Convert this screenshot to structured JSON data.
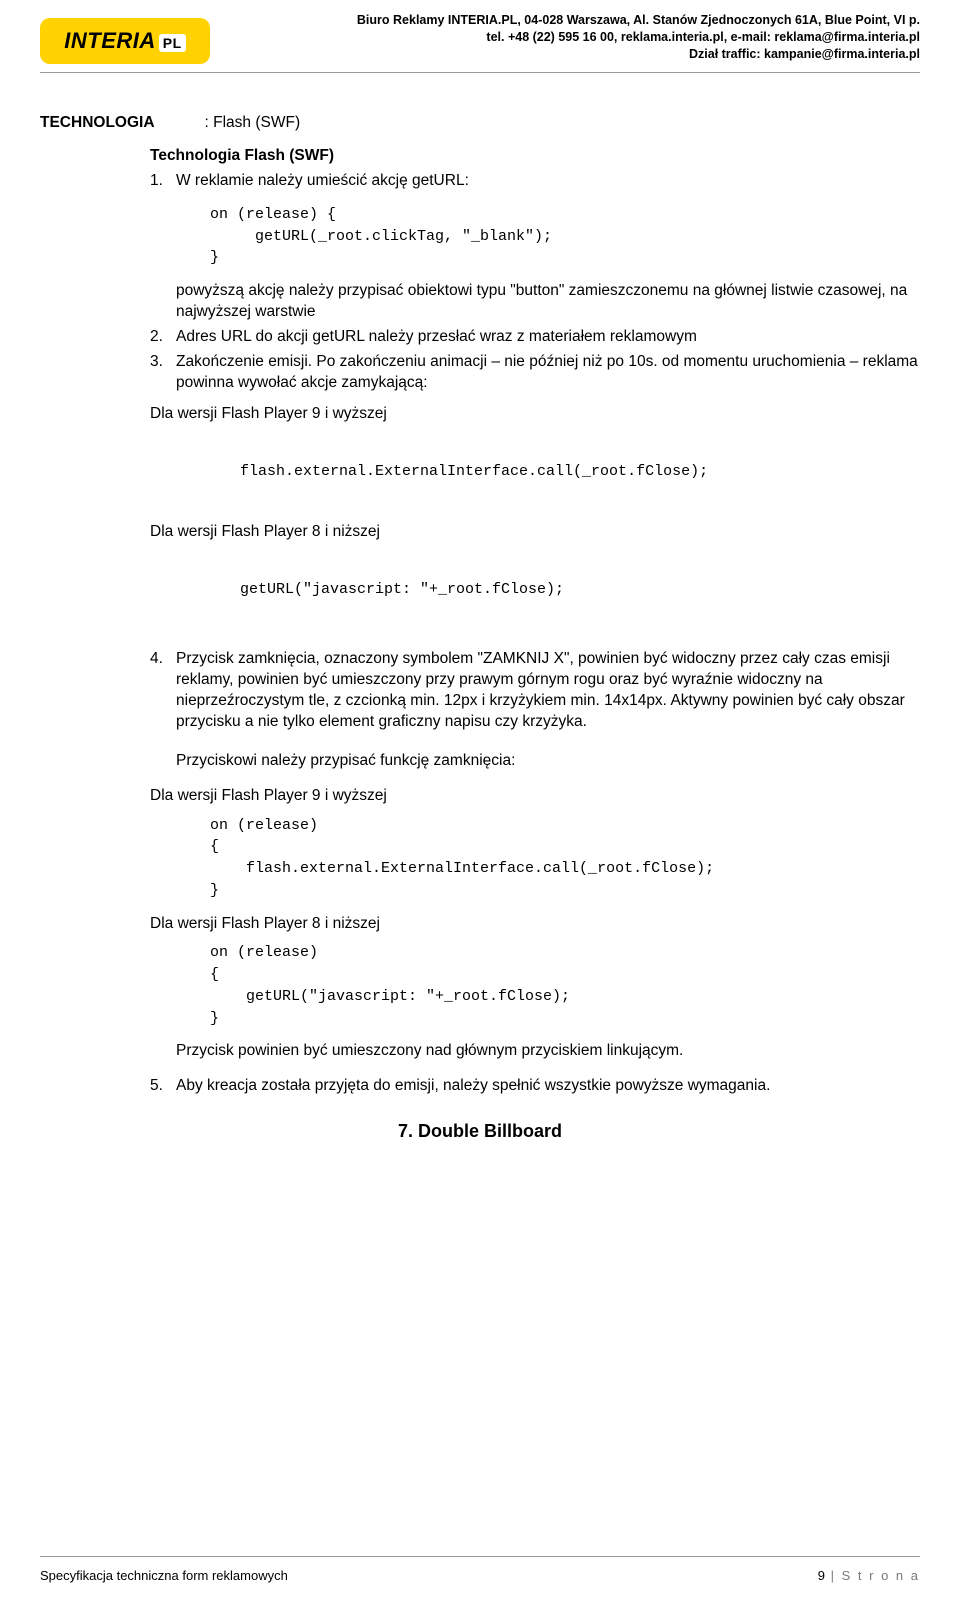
{
  "header": {
    "logo_main": "INTERIA",
    "logo_suffix": "PL",
    "line1": "Biuro Reklamy INTERIA.PL, 04-028 Warszawa, Al. Stanów Zjednoczonych 61A, Blue Point, VI p.",
    "line2": "tel. +48 (22) 595 16 00, reklama.interia.pl, e-mail: reklama@firma.interia.pl",
    "line3": "Dział traffic: kampanie@firma.interia.pl"
  },
  "tech": {
    "label": "TECHNOLOGIA",
    "value": ": Flash (SWF)"
  },
  "subtitle": "Technologia Flash (SWF)",
  "items": {
    "n1": "1.",
    "t1": "W reklamie należy umieścić akcję getURL:",
    "code1": "on (release) {\n     getURL(_root.clickTag, \"_blank\");\n}",
    "t1b": "powyższą akcję należy przypisać obiektowi typu \"button\" zamieszczonemu na głównej listwie czasowej, na najwyższej warstwie",
    "n2": "2.",
    "t2": "Adres URL do akcji getURL należy przesłać wraz z materiałem reklamowym",
    "n3": "3.",
    "t3": "Zakończenie emisji. Po zakończeniu animacji – nie później niż po 10s. od momentu uruchomienia – reklama powinna wywołać akcje zamykającą:",
    "p9": "Dla wersji Flash Player 9 i wyższej",
    "code2": "flash.external.ExternalInterface.call(_root.fClose);",
    "p8": "Dla wersji Flash Player 8 i niższej",
    "code3": "getURL(\"javascript: \"+_root.fClose);",
    "n4": "4.",
    "t4": "Przycisk zamknięcia, oznaczony symbolem \"ZAMKNIJ X\", powinien być widoczny przez cały czas emisji reklamy, powinien być umieszczony przy prawym górnym rogu oraz być wyraźnie widoczny na nieprzeźroczystym tle, z czcionką min. 12px i krzyżykiem min. 14x14px. Aktywny powinien być cały obszar przycisku a nie tylko element graficzny napisu czy krzyżyka.",
    "t4b": "Przyciskowi należy przypisać funkcję zamknięcia:",
    "code4": "on (release)\n{\n    flash.external.ExternalInterface.call(_root.fClose);\n}",
    "code5": "on (release)\n{\n    getURL(\"javascript: \"+_root.fClose);\n}",
    "t4c": "Przycisk powinien być umieszczony nad głównym przyciskiem linkującym.",
    "n5": "5.",
    "t5": "Aby kreacja została przyjęta do emisji, należy spełnić wszystkie powyższe wymagania."
  },
  "section_heading": "7. Double Billboard",
  "footer": {
    "left": "Specyfikacja techniczna form reklamowych",
    "page_num": "9",
    "sep": " | ",
    "page_word": "S t r o n a"
  }
}
